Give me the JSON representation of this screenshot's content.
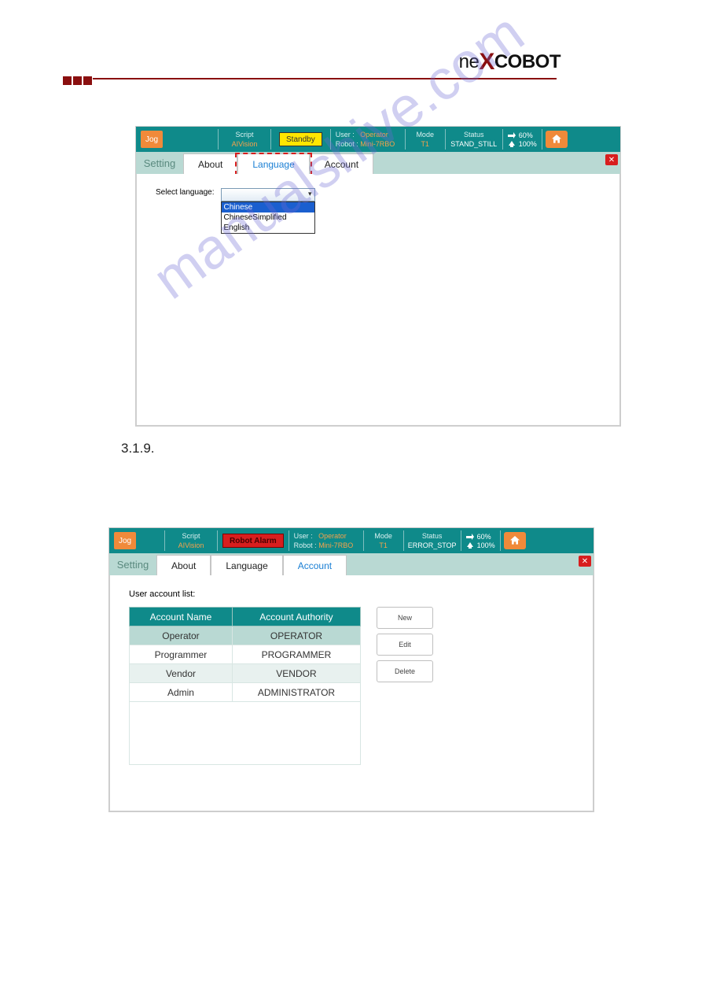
{
  "screenshot1": {
    "topbar": {
      "jog": "Jog",
      "script_lbl": "Script",
      "script_val": "AIVision",
      "status_pill": "Standby",
      "user_lbl": "User :",
      "user_val": "Operator",
      "robot_lbl": "Robot :",
      "robot_val": "Mini-7RBO",
      "mode_lbl": "Mode",
      "mode_val": "T1",
      "status_lbl": "Status",
      "status_val": "STAND_STILL",
      "speed1": "60%",
      "speed2": "100%"
    },
    "tabs": {
      "setting": "Setting",
      "about": "About",
      "language": "Language",
      "account": "Account"
    },
    "content": {
      "select_lang_lbl": "Select language:",
      "dropdown_sel": "Chinese",
      "dropdown_opt2": "ChineseSimplified",
      "dropdown_opt3": "English"
    }
  },
  "section_number": "3.1.9.",
  "screenshot2": {
    "topbar": {
      "jog": "Jog",
      "script_lbl": "Script",
      "script_val": "AIVision",
      "status_pill": "Robot Alarm",
      "user_lbl": "User :",
      "user_val": "Operator",
      "robot_lbl": "Robot :",
      "robot_val": "Mini-7RBO",
      "mode_lbl": "Mode",
      "mode_val": "T1",
      "status_lbl": "Status",
      "status_val": "ERROR_STOP",
      "speed1": "60%",
      "speed2": "100%"
    },
    "tabs": {
      "setting": "Setting",
      "about": "About",
      "language": "Language",
      "account": "Account"
    },
    "content": {
      "list_lbl": "User account list:",
      "th_name": "Account Name",
      "th_auth": "Account Authority",
      "rows": [
        {
          "name": "Operator",
          "auth": "OPERATOR"
        },
        {
          "name": "Programmer",
          "auth": "PROGRAMMER"
        },
        {
          "name": "Vendor",
          "auth": "VENDOR"
        },
        {
          "name": "Admin",
          "auth": "ADMINISTRATOR"
        }
      ],
      "btn_new": "New",
      "btn_edit": "Edit",
      "btn_delete": "Delete"
    }
  },
  "watermark": "manualshive.com"
}
